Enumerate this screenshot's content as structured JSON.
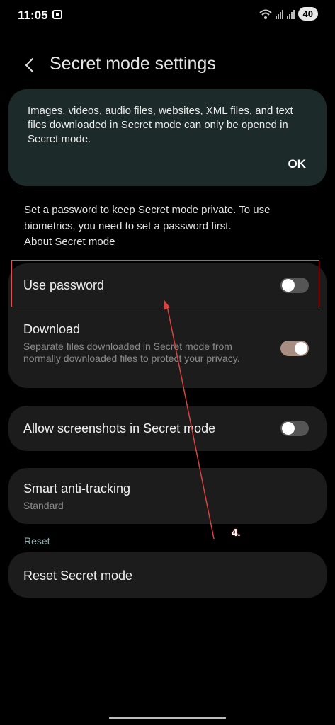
{
  "status_bar": {
    "time": "11:05",
    "battery": "40"
  },
  "header": {
    "title": "Secret mode settings"
  },
  "info_card": {
    "text": "Images, videos, audio files, websites, XML files, and text files downloaded in Secret mode can only be opened in Secret mode.",
    "ok_label": "OK"
  },
  "description": "Set a password to keep Secret mode private. To use biometrics, you need to set a password first.",
  "about_link": "About Secret mode",
  "settings": {
    "use_password": {
      "title": "Use password",
      "enabled": false
    },
    "download": {
      "title": "Download",
      "subtitle": "Separate files downloaded in Secret mode from normally downloaded files to protect your privacy.",
      "enabled": true
    },
    "screenshots": {
      "title": "Allow screenshots in Secret mode",
      "enabled": false
    },
    "anti_tracking": {
      "title": "Smart anti-tracking",
      "value": "Standard"
    }
  },
  "reset_section": {
    "header": "Reset",
    "reset_label": "Reset Secret mode"
  },
  "annotation": {
    "label": "4."
  },
  "colors": {
    "highlight": "#e34d4d",
    "toggle_on": "#a88e82",
    "toggle_off": "#555555"
  }
}
